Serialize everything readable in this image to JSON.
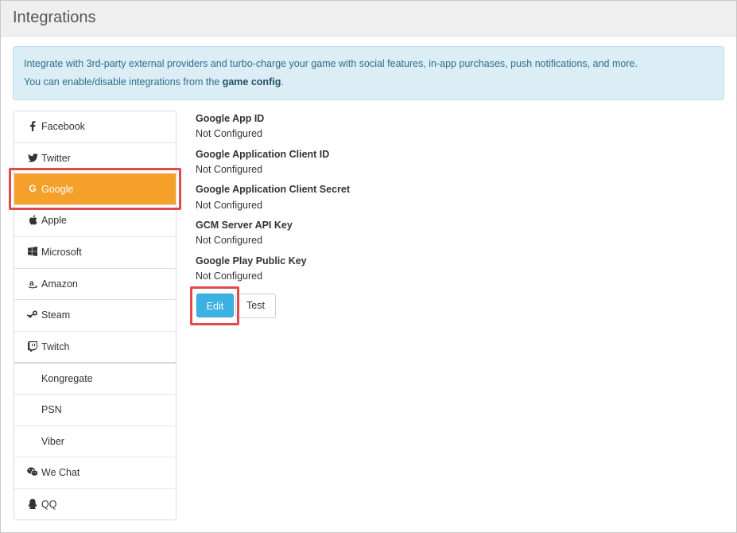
{
  "header": {
    "title": "Integrations"
  },
  "info": {
    "line1": "Integrate with 3rd-party external providers and turbo-charge your game with social features, in-app purchases, push notifications, and more.",
    "line2_prefix": "You can enable/disable integrations from the ",
    "line2_link": "game config",
    "line2_suffix": "."
  },
  "sidebar": {
    "items": [
      {
        "label": "Facebook",
        "icon": "facebook-icon"
      },
      {
        "label": "Twitter",
        "icon": "twitter-icon"
      },
      {
        "label": "Google",
        "icon": "google-icon",
        "active": true
      },
      {
        "label": "Apple",
        "icon": "apple-icon"
      },
      {
        "label": "Microsoft",
        "icon": "microsoft-icon"
      },
      {
        "label": "Amazon",
        "icon": "amazon-icon"
      },
      {
        "label": "Steam",
        "icon": "steam-icon"
      },
      {
        "label": "Twitch",
        "icon": "twitch-icon"
      },
      {
        "label": "Kongregate"
      },
      {
        "label": "PSN"
      },
      {
        "label": "Viber"
      },
      {
        "label": "We Chat",
        "icon": "wechat-icon"
      },
      {
        "label": "QQ",
        "icon": "qq-icon"
      }
    ]
  },
  "fields": [
    {
      "label": "Google App ID",
      "value": "Not Configured"
    },
    {
      "label": "Google Application Client ID",
      "value": "Not Configured"
    },
    {
      "label": "Google Application Client Secret",
      "value": "Not Configured"
    },
    {
      "label": "GCM Server API Key",
      "value": "Not Configured"
    },
    {
      "label": "Google Play Public Key",
      "value": "Not Configured"
    }
  ],
  "actions": {
    "edit": "Edit",
    "test": "Test"
  },
  "colors": {
    "accent_active": "#f5a02a",
    "primary_button": "#3cb2e2",
    "info_bg": "#dbeef6",
    "highlight": "#e04a4a"
  }
}
